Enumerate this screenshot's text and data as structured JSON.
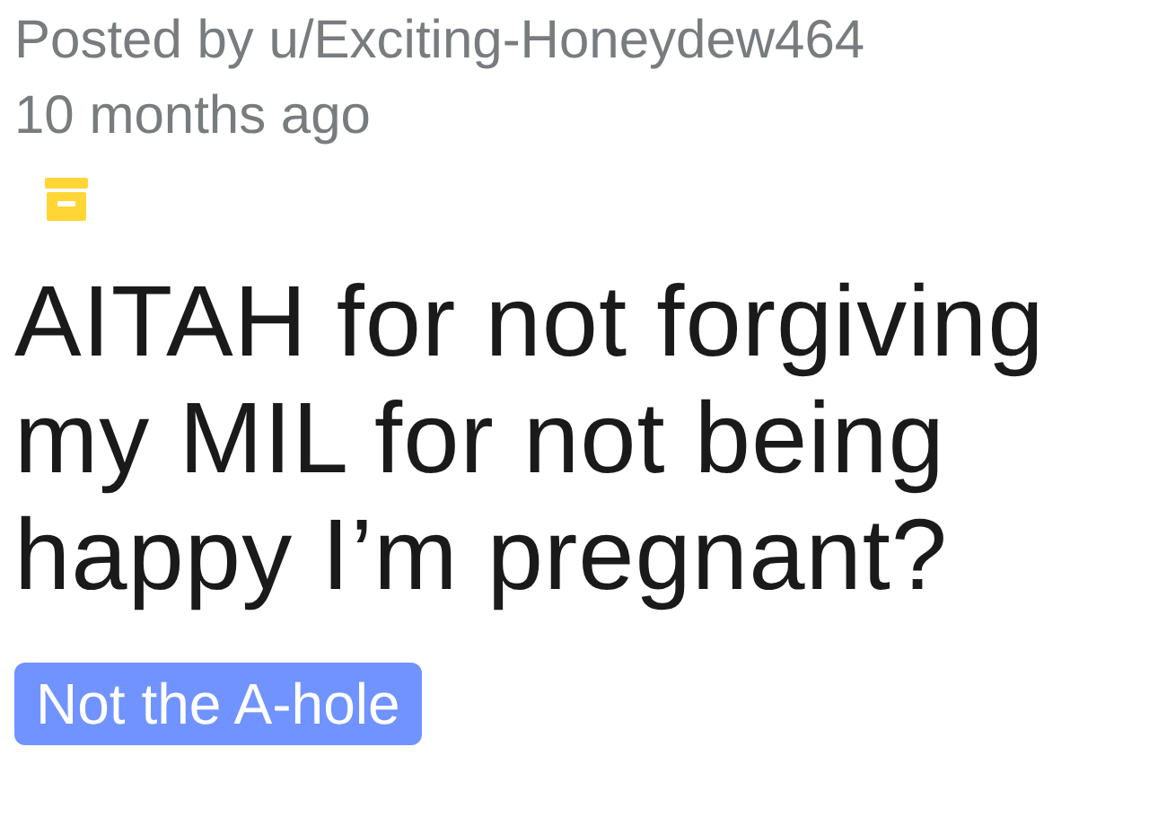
{
  "post": {
    "author_line": "Posted by u/Exciting-Honeydew464",
    "time": "10 months ago",
    "archived": true,
    "title": "AITAH for not forgiving my MIL for not being happy I’m pregnant?",
    "flair": {
      "label": "Not the A-hole",
      "color": "#7193ff"
    }
  }
}
